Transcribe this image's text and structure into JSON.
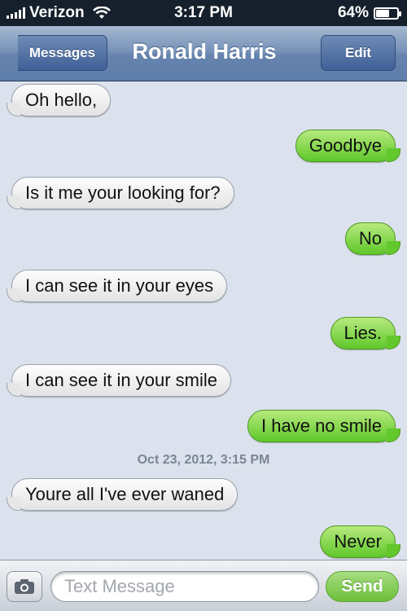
{
  "status_bar": {
    "carrier": "Verizon",
    "time": "3:17 PM",
    "battery_percent": "64%",
    "battery_level": 0.64
  },
  "nav": {
    "back_label": "Messages",
    "title": "Ronald Harris",
    "edit_label": "Edit"
  },
  "messages": [
    {
      "direction": "incoming",
      "text": "Oh hello,"
    },
    {
      "direction": "outgoing",
      "text": "Goodbye"
    },
    {
      "direction": "incoming",
      "text": "Is it me your looking for?"
    },
    {
      "direction": "outgoing",
      "text": "No"
    },
    {
      "direction": "incoming",
      "text": "I can see it in your eyes"
    },
    {
      "direction": "outgoing",
      "text": "Lies."
    },
    {
      "direction": "incoming",
      "text": "I can see it in your smile"
    },
    {
      "direction": "outgoing",
      "text": "I have no smile"
    },
    {
      "direction": "incoming",
      "text": "Youre all I've ever waned"
    },
    {
      "direction": "outgoing",
      "text": "Never"
    }
  ],
  "timestamp": "Oct 23, 2012, 3:15 PM",
  "input": {
    "placeholder": "Text Message",
    "value": "",
    "send_label": "Send"
  },
  "colors": {
    "outgoing_bubble": "#7ed348",
    "incoming_bubble": "#f2f2f2",
    "nav_bar": "#6f8bb5",
    "thread_background": "#dbe2ed"
  },
  "icons": [
    "signal-icon",
    "wifi-icon",
    "battery-icon",
    "camera-icon"
  ]
}
